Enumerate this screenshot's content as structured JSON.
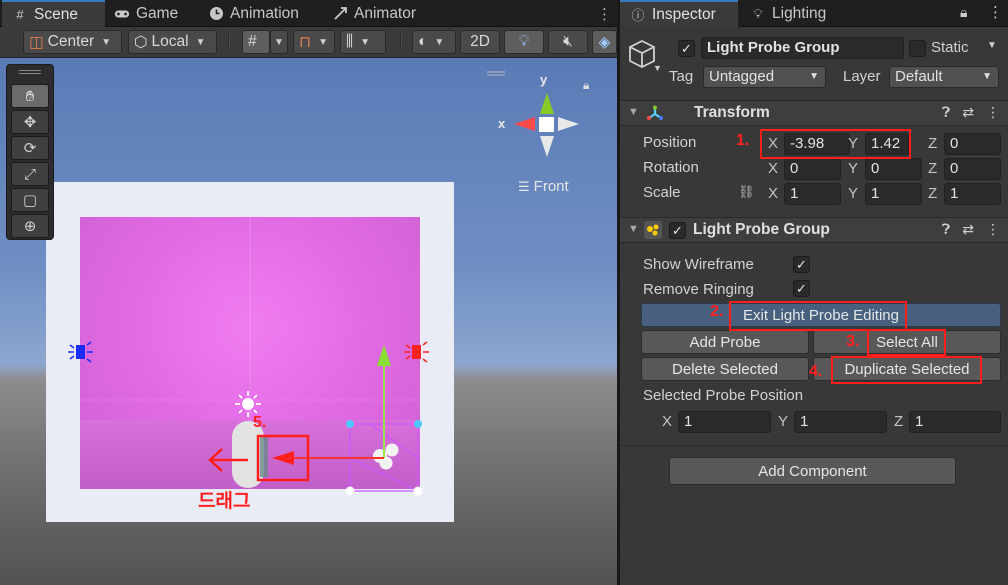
{
  "scene_tabs": [
    {
      "label": "Scene",
      "icon": "hashtag-icon"
    },
    {
      "label": "Game",
      "icon": "gamepad-icon"
    },
    {
      "label": "Animation",
      "icon": "clock-icon"
    },
    {
      "label": "Animator",
      "icon": "animator-icon"
    }
  ],
  "scene_toolbar": {
    "pivot_mode": "Center",
    "pivot_rotation": "Local",
    "mode_2d": "2D"
  },
  "tool_palette": [
    "hand-tool",
    "move-tool",
    "rotate-tool",
    "scale-tool",
    "rect-tool",
    "transform-tool"
  ],
  "gizmo": {
    "axis_y": "y",
    "axis_x": "x",
    "view_label": "Front"
  },
  "scene_annotations": {
    "step5": "5.",
    "drag_text": "드래그"
  },
  "inspector_tabs": [
    {
      "label": "Inspector",
      "icon": "info-icon"
    },
    {
      "label": "Lighting",
      "icon": "bulb-icon"
    }
  ],
  "object_header": {
    "enabled": true,
    "name": "Light Probe Group",
    "static_label": "Static",
    "static_checked": false,
    "tag_label": "Tag",
    "tag_value": "Untagged",
    "layer_label": "Layer",
    "layer_value": "Default"
  },
  "transform": {
    "title": "Transform",
    "position_label": "Position",
    "rotation_label": "Rotation",
    "scale_label": "Scale",
    "position": {
      "x": "-3.98",
      "y": "1.42",
      "z": "0"
    },
    "rotation": {
      "x": "0",
      "y": "0",
      "z": "0"
    },
    "scale": {
      "x": "1",
      "y": "1",
      "z": "1"
    },
    "axis_labels": {
      "x": "X",
      "y": "Y",
      "z": "Z"
    }
  },
  "light_probe_group": {
    "title": "Light Probe Group",
    "enabled": true,
    "show_wireframe_label": "Show Wireframe",
    "show_wireframe": true,
    "remove_ringing_label": "Remove Ringing",
    "remove_ringing": true,
    "exit_editing_label": "Exit Light Probe Editing",
    "add_probe_label": "Add Probe",
    "select_all_label": "Select All",
    "delete_selected_label": "Delete Selected",
    "duplicate_selected_label": "Duplicate Selected",
    "selected_probe_position_label": "Selected Probe Position",
    "selected_probe_position": {
      "x": "1",
      "y": "1",
      "z": "1"
    }
  },
  "add_component_label": "Add Component",
  "annotations": {
    "step1": "1.",
    "step2": "2.",
    "step3": "3.",
    "step4": "4."
  },
  "colors": {
    "annotation_red": "#ff1e1e",
    "accent_blue": "#3a79bb",
    "room_pink": "#e16ae4"
  }
}
